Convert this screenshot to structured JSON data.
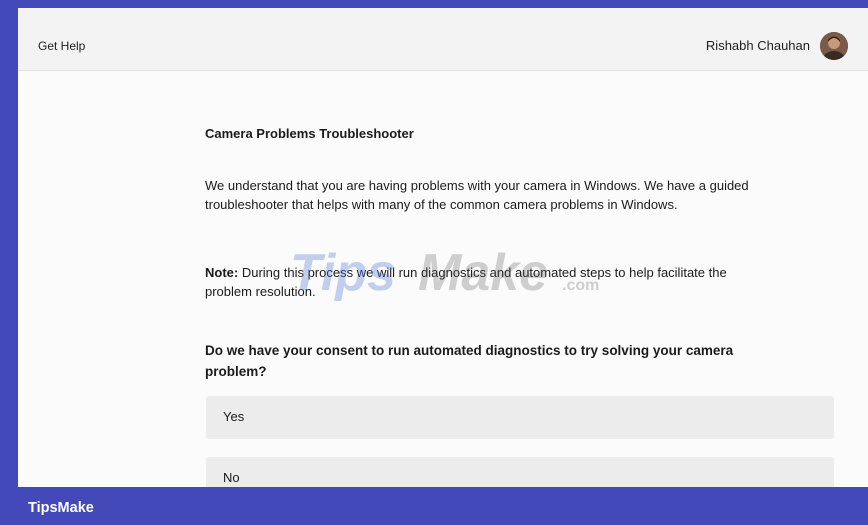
{
  "app": {
    "title": "Get Help"
  },
  "user": {
    "name": "Rishabh Chauhan"
  },
  "content": {
    "heading": "Camera Problems Troubleshooter",
    "paragraph1": "We understand that you are having problems with your camera in Windows. We have a guided troubleshooter that helps with many of the common camera problems in Windows.",
    "note_label": "Note:",
    "note_text": " During this process we will run diagnostics and automated steps to help facilitate the problem resolution.",
    "question": "Do we have your consent to run automated diagnostics to try solving your camera problem?",
    "options": [
      {
        "label": "Yes"
      },
      {
        "label": "No"
      }
    ]
  },
  "watermark": {
    "brand_left": "Tips",
    "brand_right": "Make",
    "suffix": ".com"
  },
  "footer": {
    "brand": "TipsMake"
  },
  "colors": {
    "frame": "#4349b8",
    "option_bg": "#ececec",
    "titlebar_bg": "#f3f3f3"
  }
}
